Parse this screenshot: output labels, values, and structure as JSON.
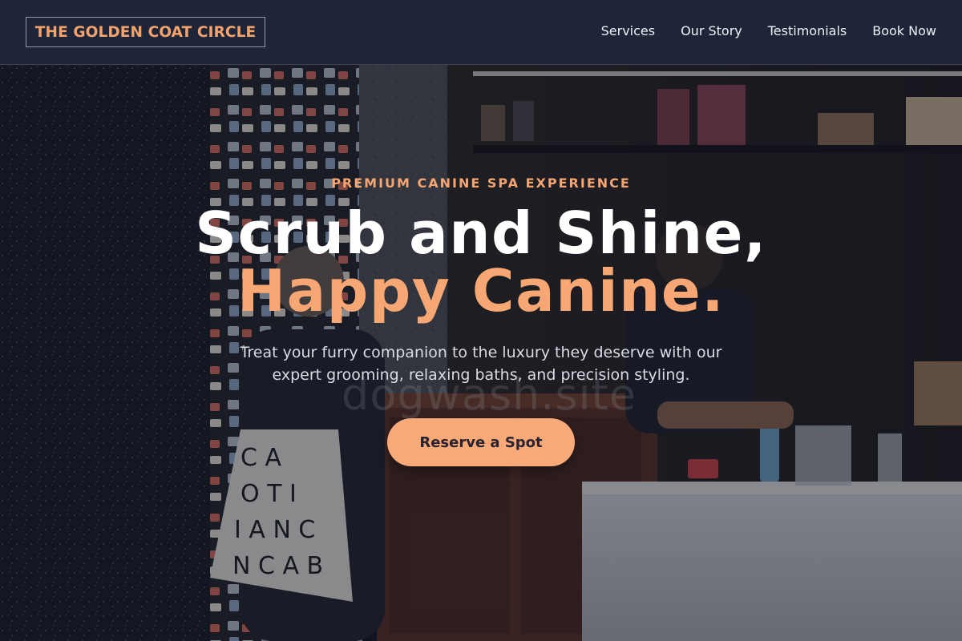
{
  "brand": {
    "name": "THE GOLDEN COAT CIRCLE",
    "accent_color": "#f6a773"
  },
  "nav": {
    "items": [
      {
        "label": "Services"
      },
      {
        "label": "Our Story"
      },
      {
        "label": "Testimonials"
      },
      {
        "label": "Book Now"
      }
    ]
  },
  "hero": {
    "eyebrow": "PREMIUM CANINE SPA EXPERIENCE",
    "headline_line1": "Scrub and Shine,",
    "headline_line2": "Happy Canine.",
    "subtext": "Treat your furry companion to the luxury they deserve with our expert grooming, relaxing baths, and precision styling.",
    "cta_label": "Reserve a Spot",
    "photo_watermark": "dogwash.site",
    "tote_bag_letters": "C A\nO T I\nI A N C\nN C A B"
  }
}
